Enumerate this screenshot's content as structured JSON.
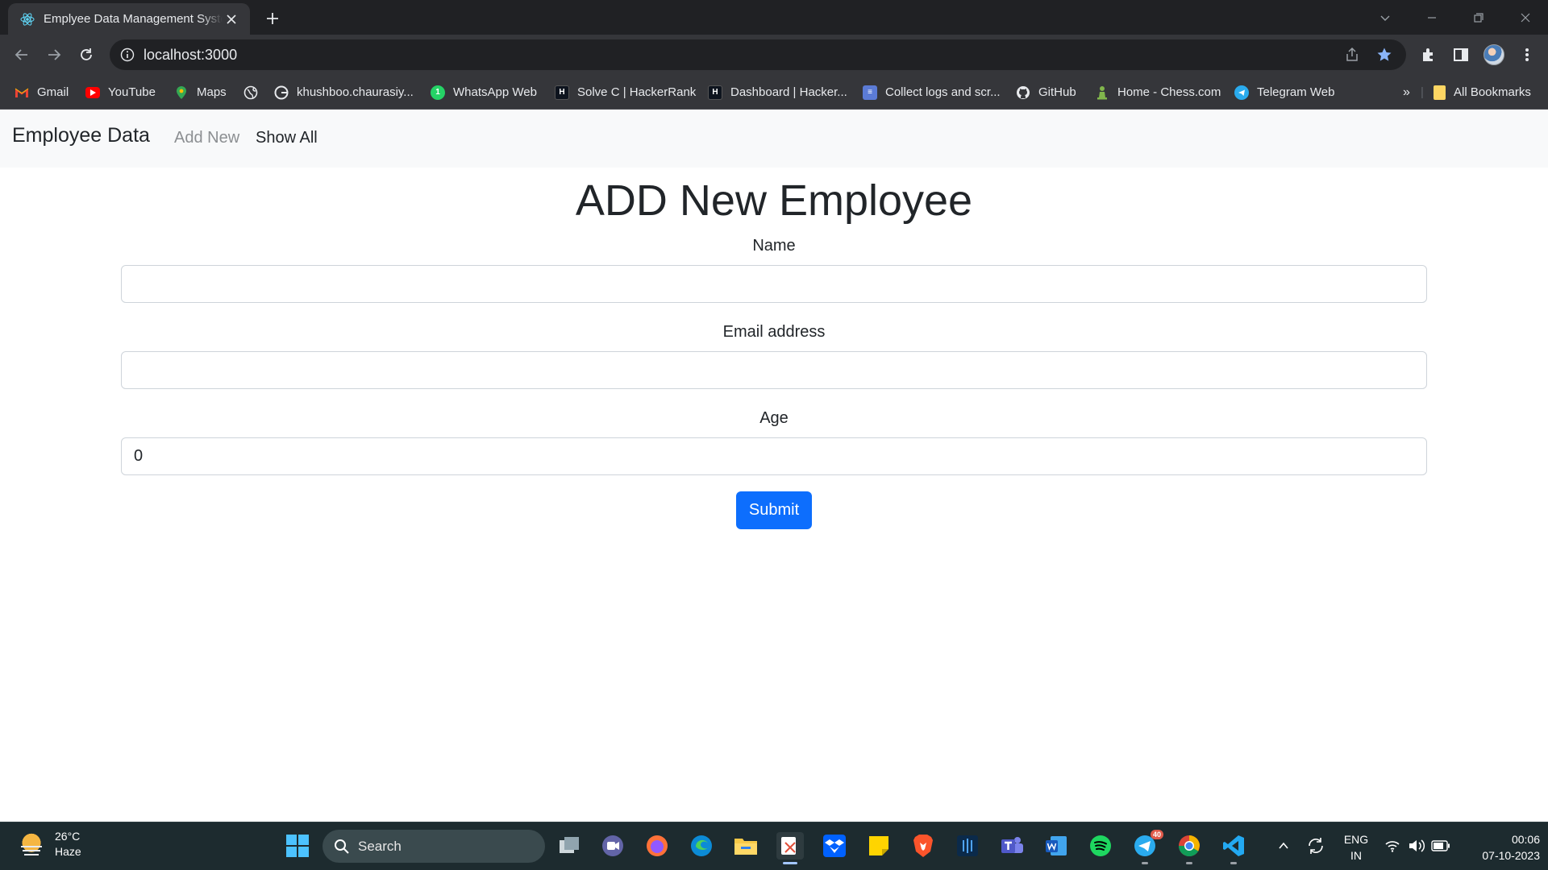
{
  "browser": {
    "tab_title": "Emplyee Data Management System",
    "url": "localhost:3000",
    "bookmarks": [
      {
        "label": "Gmail",
        "icon": "gmail-icon"
      },
      {
        "label": "YouTube",
        "icon": "youtube-icon"
      },
      {
        "label": "Maps",
        "icon": "maps-icon"
      },
      {
        "label": "",
        "icon": "globe-icon"
      },
      {
        "label": "khushboo.chaurasiy...",
        "icon": "google-icon"
      },
      {
        "label": "WhatsApp Web",
        "icon": "whatsapp-icon"
      },
      {
        "label": "Solve C | HackerRank",
        "icon": "hackerrank-icon"
      },
      {
        "label": "Dashboard | Hacker...",
        "icon": "hackerrank-icon"
      },
      {
        "label": "Collect logs and scr...",
        "icon": "logs-icon"
      },
      {
        "label": "GitHub",
        "icon": "github-icon"
      },
      {
        "label": "Home - Chess.com",
        "icon": "chess-icon"
      },
      {
        "label": "Telegram Web",
        "icon": "telegram-icon"
      }
    ],
    "all_bookmarks": "All Bookmarks",
    "overflow": "»"
  },
  "app": {
    "brand": "Employee Data",
    "nav_add": "Add New",
    "nav_show": "Show All"
  },
  "form": {
    "heading": "ADD New Employee",
    "name_label": "Name",
    "name_value": "",
    "email_label": "Email address",
    "email_value": "",
    "age_label": "Age",
    "age_value": "0",
    "submit": "Submit"
  },
  "taskbar": {
    "temperature": "26°C",
    "weather": "Haze",
    "search": "Search",
    "lang_top": "ENG",
    "lang_bottom": "IN",
    "time": "00:06",
    "date": "07-10-2023",
    "telegram_badge": "40"
  },
  "colors": {
    "primary": "#0d6efd",
    "navbar_bg": "#f8f9fa",
    "chrome_dark": "#202124",
    "chrome_toolbar": "#35363a",
    "taskbar_bg": "#1d2b2f"
  }
}
